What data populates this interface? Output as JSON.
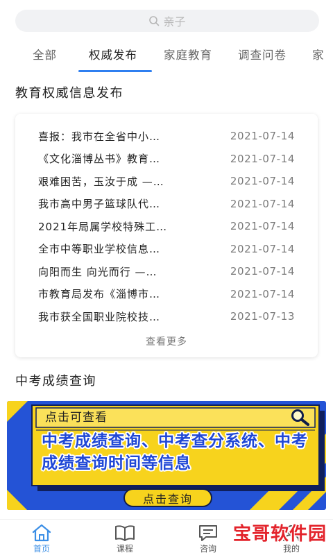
{
  "search": {
    "placeholder": "亲子",
    "icon": "search-icon"
  },
  "tabs": [
    {
      "label": "全部",
      "active": false
    },
    {
      "label": "权威发布",
      "active": true
    },
    {
      "label": "家庭教育",
      "active": false
    },
    {
      "label": "调查问卷",
      "active": false
    },
    {
      "label": "家",
      "active": false
    }
  ],
  "news_section": {
    "title": "教育权威信息发布",
    "more_label": "查看更多",
    "items": [
      {
        "title": "喜报：我市在全省中小…",
        "date": "2021-07-14"
      },
      {
        "title": "《文化淄博丛书》教育…",
        "date": "2021-07-14"
      },
      {
        "title": "艰难困苦，玉汝于成 —…",
        "date": "2021-07-14"
      },
      {
        "title": "我市高中男子篮球队代…",
        "date": "2021-07-14"
      },
      {
        "title": "2021年局属学校特殊工…",
        "date": "2021-07-14"
      },
      {
        "title": "全市中等职业学校信息…",
        "date": "2021-07-14"
      },
      {
        "title": "向阳而生 向光而行 —…",
        "date": "2021-07-14"
      },
      {
        "title": "市教育局发布《淄博市…",
        "date": "2021-07-14"
      },
      {
        "title": "我市获全国职业院校技…",
        "date": "2021-07-13"
      }
    ]
  },
  "exam_section": {
    "title": "中考成绩查询",
    "banner": {
      "hint": "点击可查看",
      "line1": "中考成绩查询、中考查分系统、中考",
      "line2": "成绩查询时间等信息",
      "button": "点击查询",
      "icon": "magnifier-icon"
    }
  },
  "bottom_nav": [
    {
      "label": "首页",
      "icon": "home-icon",
      "active": true
    },
    {
      "label": "课程",
      "icon": "book-icon",
      "active": false
    },
    {
      "label": "咨询",
      "icon": "chat-icon",
      "active": false
    },
    {
      "label": "我的",
      "icon": "user-icon",
      "active": false
    }
  ],
  "watermark": "宝哥软件园",
  "colors": {
    "accent": "#2f7ff0",
    "nav_active": "#3a8ee6",
    "banner_blue": "#2453d6",
    "banner_yellow": "#f7d31d",
    "watermark_red": "#e3232b"
  }
}
